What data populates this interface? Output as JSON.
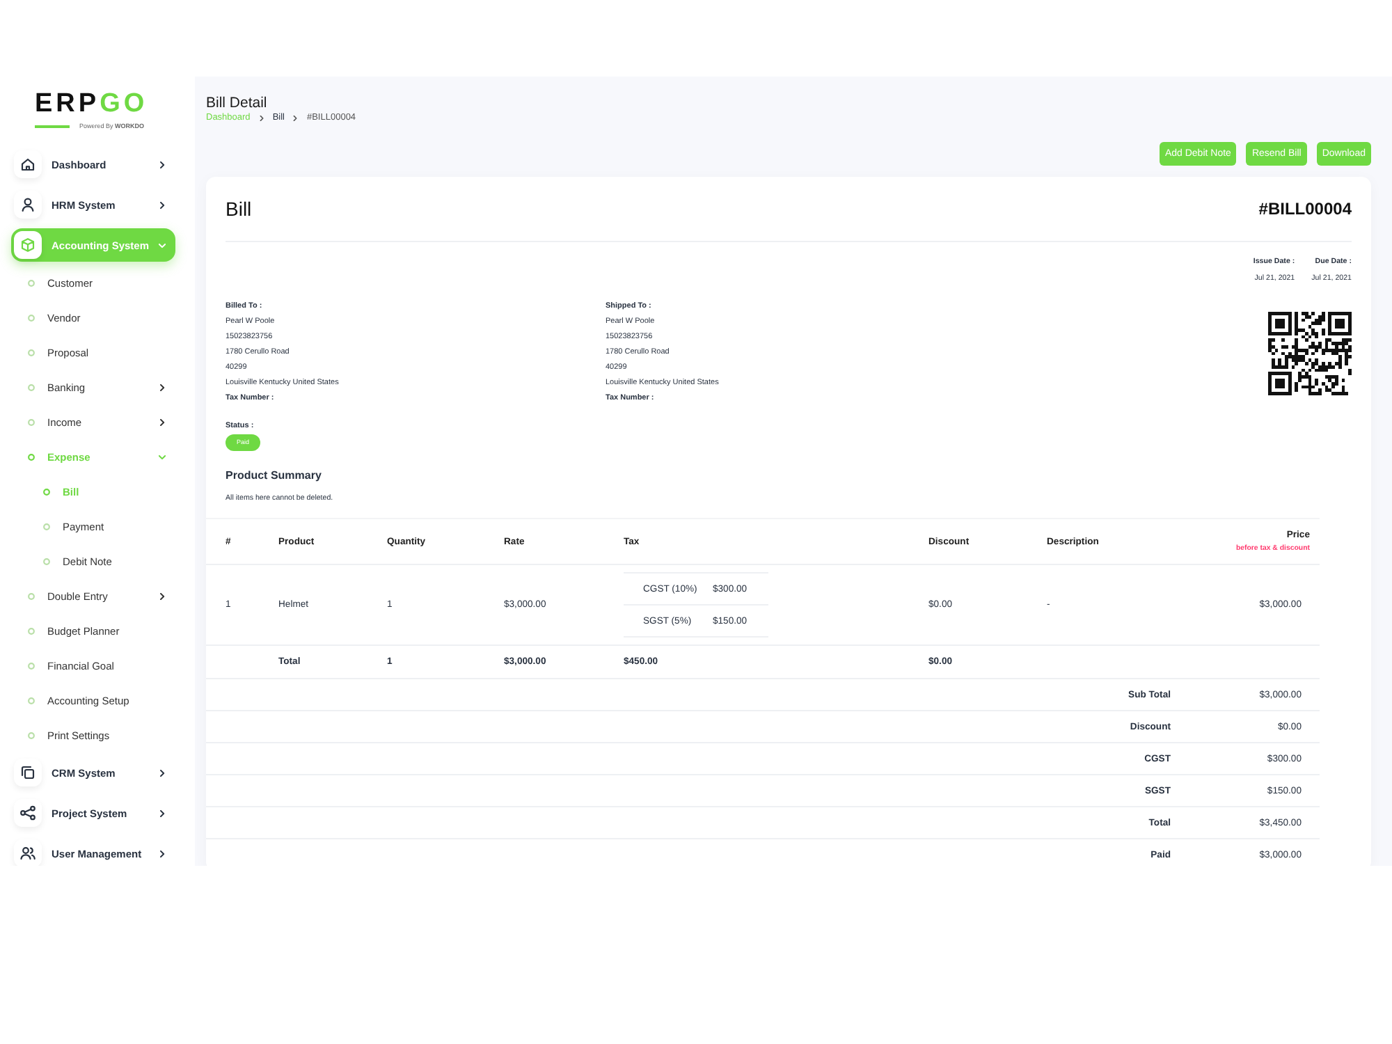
{
  "logo": {
    "brand_dark": "ERP",
    "brand_accent": "GO",
    "tagline": "Powered By **WORKDO**"
  },
  "sidebar": {
    "items": [
      {
        "label": "Dashboard",
        "selected": false,
        "expanded": false
      },
      {
        "label": "HRM System",
        "selected": false,
        "expanded": false
      },
      {
        "label": "Accounting System",
        "selected": true,
        "expanded": true,
        "children": [
          {
            "label": "Customer",
            "kind": "link",
            "selected": false
          },
          {
            "label": "Vendor",
            "kind": "link",
            "selected": false
          },
          {
            "label": "Proposal",
            "kind": "link",
            "selected": false
          },
          {
            "label": "Banking",
            "kind": "group",
            "selected": false,
            "expanded": false
          },
          {
            "label": "Income",
            "kind": "group",
            "selected": false,
            "expanded": false
          },
          {
            "label": "Expense",
            "kind": "group",
            "selected": true,
            "expanded": true,
            "children": [
              {
                "label": "Bill",
                "selected": true
              },
              {
                "label": "Payment",
                "selected": false
              },
              {
                "label": "Debit Note",
                "selected": false
              }
            ]
          },
          {
            "label": "Double Entry",
            "kind": "group",
            "selected": false,
            "expanded": false
          },
          {
            "label": "Budget Planner",
            "kind": "link",
            "selected": false
          },
          {
            "label": "Financial Goal",
            "kind": "link",
            "selected": false
          },
          {
            "label": "Accounting Setup",
            "kind": "link",
            "selected": false
          },
          {
            "label": "Print Settings",
            "kind": "link",
            "selected": false
          }
        ]
      },
      {
        "label": "CRM System",
        "selected": false,
        "expanded": false
      },
      {
        "label": "Project System",
        "selected": false,
        "expanded": false
      },
      {
        "label": "User Management",
        "selected": false,
        "expanded": false
      }
    ]
  },
  "header": {
    "title": "Bill Detail",
    "breadcrumb": [
      {
        "label": "Dashboard",
        "kind": "link"
      },
      {
        "label": "Bill",
        "kind": "crumb"
      },
      {
        "label": "#BILL00004",
        "kind": "current"
      }
    ]
  },
  "actions": [
    "Add Debit Note",
    "Resend Bill",
    "Download"
  ],
  "bill": {
    "title": "Bill",
    "number": "#BILL00004",
    "dates": [
      {
        "label": "Issue Date :",
        "value": "Jul 21, 2021"
      },
      {
        "label": "Due Date :",
        "value": "Jul 21, 2021"
      }
    ],
    "addresses": [
      {
        "heading": "Billed To :",
        "lines": [
          "Pearl W Poole",
          "15023823756",
          "1780 Cerullo Road",
          "40299",
          "Louisville Kentucky United States"
        ],
        "tax_label": "Tax Number :"
      },
      {
        "heading": "Shipped To :",
        "lines": [
          "Pearl W Poole",
          "15023823756",
          "1780 Cerullo Road",
          "40299",
          "Louisville Kentucky United States"
        ],
        "tax_label": "Tax Number :"
      }
    ],
    "status": {
      "label": "Status :",
      "value": "Paid"
    }
  },
  "product_summary": {
    "title": "Product Summary",
    "note": "All items here cannot be deleted."
  },
  "table": {
    "columns": [
      {
        "label": "#"
      },
      {
        "label": "Product"
      },
      {
        "label": "Quantity"
      },
      {
        "label": "Rate"
      },
      {
        "label": "Tax"
      },
      {
        "label": "Discount"
      },
      {
        "label": "Description"
      },
      {
        "label": "Price",
        "note": "before tax & discount"
      }
    ],
    "rows": [
      {
        "number": "1",
        "product": "Helmet",
        "quantity": "1",
        "rate": "$3,000.00",
        "taxes": [
          {
            "name": "CGST (10%)",
            "amount": "$300.00"
          },
          {
            "name": "SGST (5%)",
            "amount": "$150.00"
          }
        ],
        "discount": "$0.00",
        "description": "-",
        "price": "$3,000.00"
      }
    ],
    "total": {
      "label": "Total",
      "quantity": "1",
      "rate": "$3,000.00",
      "tax": "$450.00",
      "discount": "$0.00"
    },
    "summary": [
      {
        "label": "Sub Total",
        "value": "$3,000.00"
      },
      {
        "label": "Discount",
        "value": "$0.00"
      },
      {
        "label": "CGST",
        "value": "$300.00"
      },
      {
        "label": "SGST",
        "value": "$150.00"
      },
      {
        "label": "Total",
        "value": "$3,450.00"
      },
      {
        "label": "Paid",
        "value": "$3,000.00"
      }
    ]
  }
}
